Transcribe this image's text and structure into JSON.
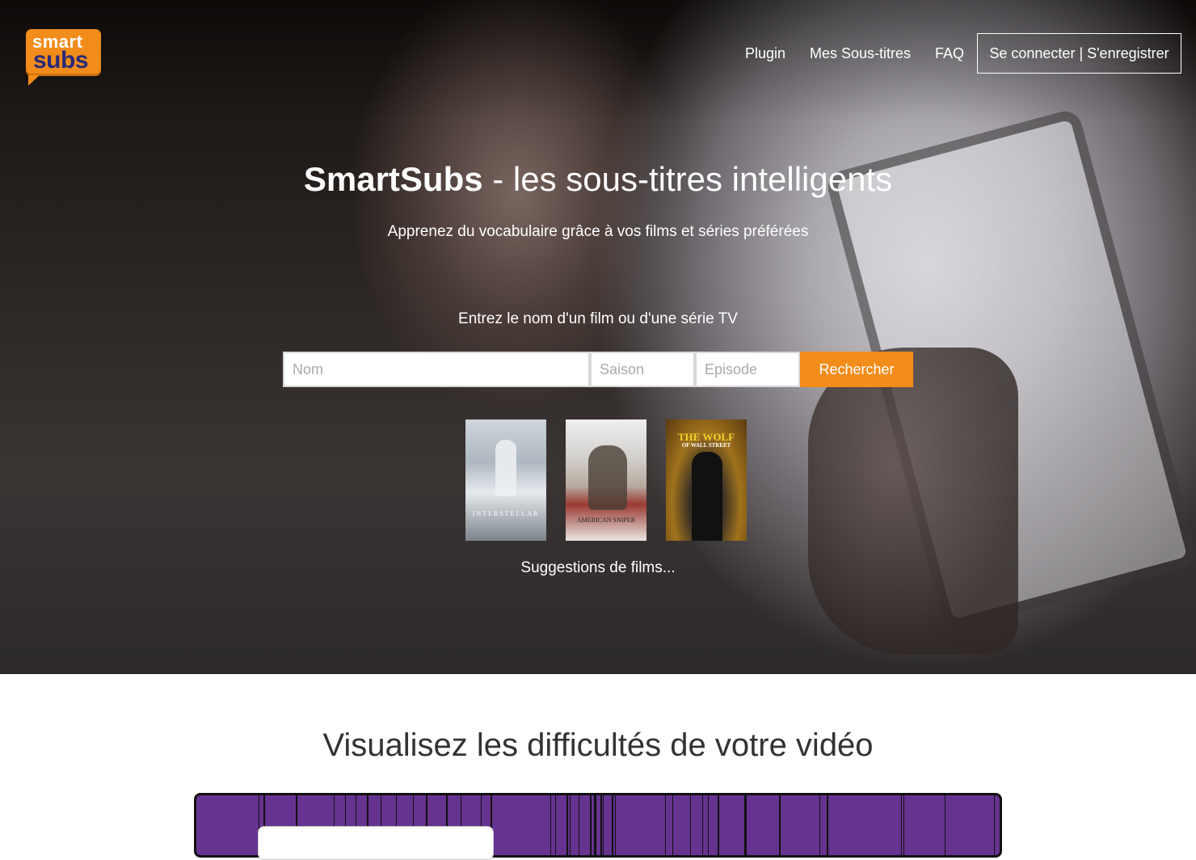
{
  "header": {
    "logo": {
      "line1": "smart",
      "line2": "subs",
      "accent": "#f28c1a"
    },
    "nav": [
      "Plugin",
      "Mes Sous-titres",
      "FAQ"
    ],
    "login_label": "Se connecter | S'enregistrer"
  },
  "hero": {
    "title_brand": "SmartSubs",
    "title_rest": " - les sous-titres intelligents",
    "subtitle": "Apprenez du vocabulaire grâce à vos films et séries préférées",
    "prompt": "Entrez le nom d'un film ou d'une série TV",
    "search": {
      "name_placeholder": "Nom",
      "season_placeholder": "Saison",
      "episode_placeholder": "Episode",
      "button_label": "Rechercher"
    },
    "posters": [
      {
        "title": "INTERSTELLAR"
      },
      {
        "title": "AMERICAN SNIPER"
      },
      {
        "title": "THE WOLF",
        "subtitle": "OF WALL STREET"
      }
    ],
    "suggestions_label": "Suggestions de films..."
  },
  "section": {
    "title": "Visualisez les difficultés de votre vidéo",
    "timeline_color": "#673390"
  }
}
